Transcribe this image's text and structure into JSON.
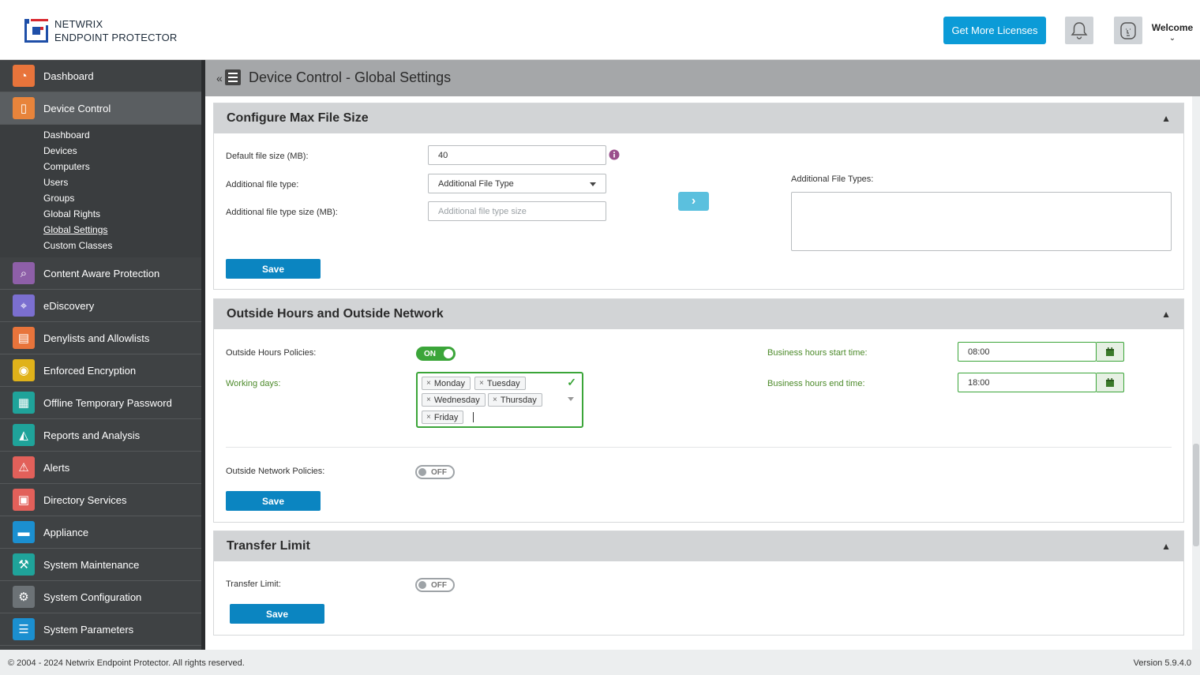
{
  "brand": {
    "line1": "NETWRIX",
    "line2": "ENDPOINT PROTECTOR"
  },
  "header": {
    "licenses_button": "Get More Licenses",
    "welcome": "Welcome",
    "welcome_chevron": "⌄"
  },
  "sidebar": {
    "items": [
      {
        "label": "Dashboard",
        "icon": "pie-chart-icon",
        "color": "#e8743b"
      },
      {
        "label": "Device Control",
        "icon": "usb-drive-icon",
        "color": "#e8843b"
      },
      {
        "label": "Content Aware Protection",
        "icon": "document-search-icon",
        "color": "#8e5fa8"
      },
      {
        "label": "eDiscovery",
        "icon": "telescope-icon",
        "color": "#7b6fd0"
      },
      {
        "label": "Denylists and Allowlists",
        "icon": "list-window-icon",
        "color": "#e8743b"
      },
      {
        "label": "Enforced Encryption",
        "icon": "lock-circle-icon",
        "color": "#e0b21a"
      },
      {
        "label": "Offline Temporary Password",
        "icon": "keypad-icon",
        "color": "#1fa39a"
      },
      {
        "label": "Reports and Analysis",
        "icon": "area-chart-icon",
        "color": "#1fa39a"
      },
      {
        "label": "Alerts",
        "icon": "warning-icon",
        "color": "#e2605a"
      },
      {
        "label": "Directory Services",
        "icon": "briefcase-icon",
        "color": "#e2605a"
      },
      {
        "label": "Appliance",
        "icon": "server-icon",
        "color": "#1b8fd0"
      },
      {
        "label": "System Maintenance",
        "icon": "tools-icon",
        "color": "#1fa39a"
      },
      {
        "label": "System Configuration",
        "icon": "gear-icon",
        "color": "#6c7276"
      },
      {
        "label": "System Parameters",
        "icon": "checklist-icon",
        "color": "#1b8fd0"
      }
    ],
    "sub_items": [
      "Dashboard",
      "Devices",
      "Computers",
      "Users",
      "Groups",
      "Global Rights",
      "Global Settings",
      "Custom Classes"
    ]
  },
  "page": {
    "collapse": "«",
    "title": "Device Control - Global Settings"
  },
  "max_file_size": {
    "title": "Configure Max File Size",
    "default_label": "Default file size (MB):",
    "default_value": "40",
    "type_label": "Additional file type:",
    "type_value": "Additional File Type",
    "type_size_label": "Additional file type size (MB):",
    "type_size_placeholder": "Additional file type size",
    "types_list_label": "Additional File Types:",
    "save": "Save"
  },
  "outside": {
    "title": "Outside Hours and Outside Network",
    "hours_label": "Outside Hours Policies:",
    "hours_toggle": "ON",
    "working_days_label": "Working days:",
    "working_days": [
      "Monday",
      "Tuesday",
      "Wednesday",
      "Thursday",
      "Friday"
    ],
    "start_label": "Business hours start time:",
    "start_value": "08:00",
    "end_label": "Business hours end time:",
    "end_value": "18:00",
    "network_label": "Outside Network Policies:",
    "network_toggle": "OFF",
    "save": "Save"
  },
  "transfer": {
    "title": "Transfer Limit",
    "label": "Transfer Limit:",
    "toggle": "OFF",
    "save": "Save"
  },
  "footer": {
    "copyright": "© 2004 - 2024 Netwrix Endpoint Protector. All rights reserved.",
    "version": "Version 5.9.4.0"
  }
}
